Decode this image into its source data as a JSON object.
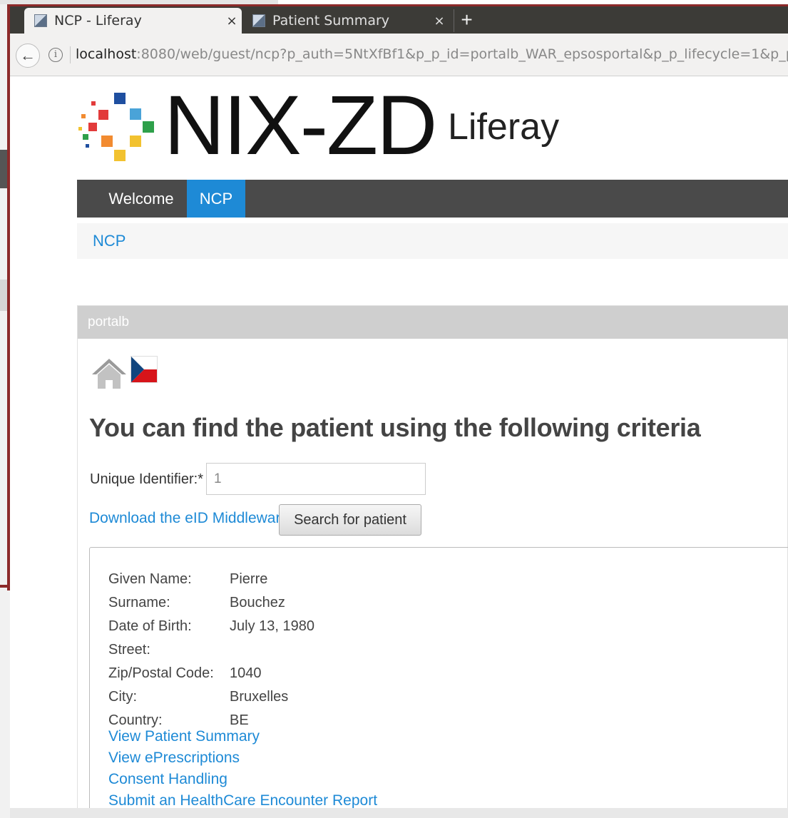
{
  "browser": {
    "tabs": [
      {
        "title": "NCP - Liferay",
        "close": "×"
      },
      {
        "title": "Patient Summary",
        "close": "×"
      }
    ],
    "new_tab": "+",
    "url_host": "localhost",
    "url_rest": ":8080/web/guest/ncp?p_auth=5NtXfBf1&p_p_id=portalb_WAR_epsosportal&p_p_lifecycle=1&p_p",
    "back_icon": "←",
    "info_icon": "i"
  },
  "header": {
    "brand": "NIX-ZD",
    "sub": "Liferay"
  },
  "nav": {
    "items": [
      {
        "label": "Welcome"
      },
      {
        "label": "NCP"
      }
    ],
    "active_color": "#1e8ad6"
  },
  "breadcrumb": {
    "current": "NCP"
  },
  "portlet": {
    "title": "portalb",
    "heading": "You can find the patient using the following criteria",
    "identifier_label": "Unique Identifier:*",
    "identifier_value": "1",
    "download_link": "Download the eID Middleware",
    "search_button": "Search for patient"
  },
  "patient": {
    "fields": [
      {
        "label": "Given Name:",
        "value": "Pierre"
      },
      {
        "label": "Surname:",
        "value": "Bouchez"
      },
      {
        "label": "Date of Birth:",
        "value": "July 13, 1980"
      },
      {
        "label": "Street:",
        "value": ""
      },
      {
        "label": "Zip/Postal Code:",
        "value": "1040"
      },
      {
        "label": "City:",
        "value": "Bruxelles"
      },
      {
        "label": "Country:",
        "value": "BE"
      }
    ],
    "links": [
      "View Patient Summary",
      "View ePrescriptions",
      "Consent Handling",
      "Submit an HealthCare Encounter Report"
    ]
  },
  "colors": {
    "link": "#1e8ad6",
    "navbar": "#4a4a4a",
    "frame": "#8c2a2a"
  }
}
